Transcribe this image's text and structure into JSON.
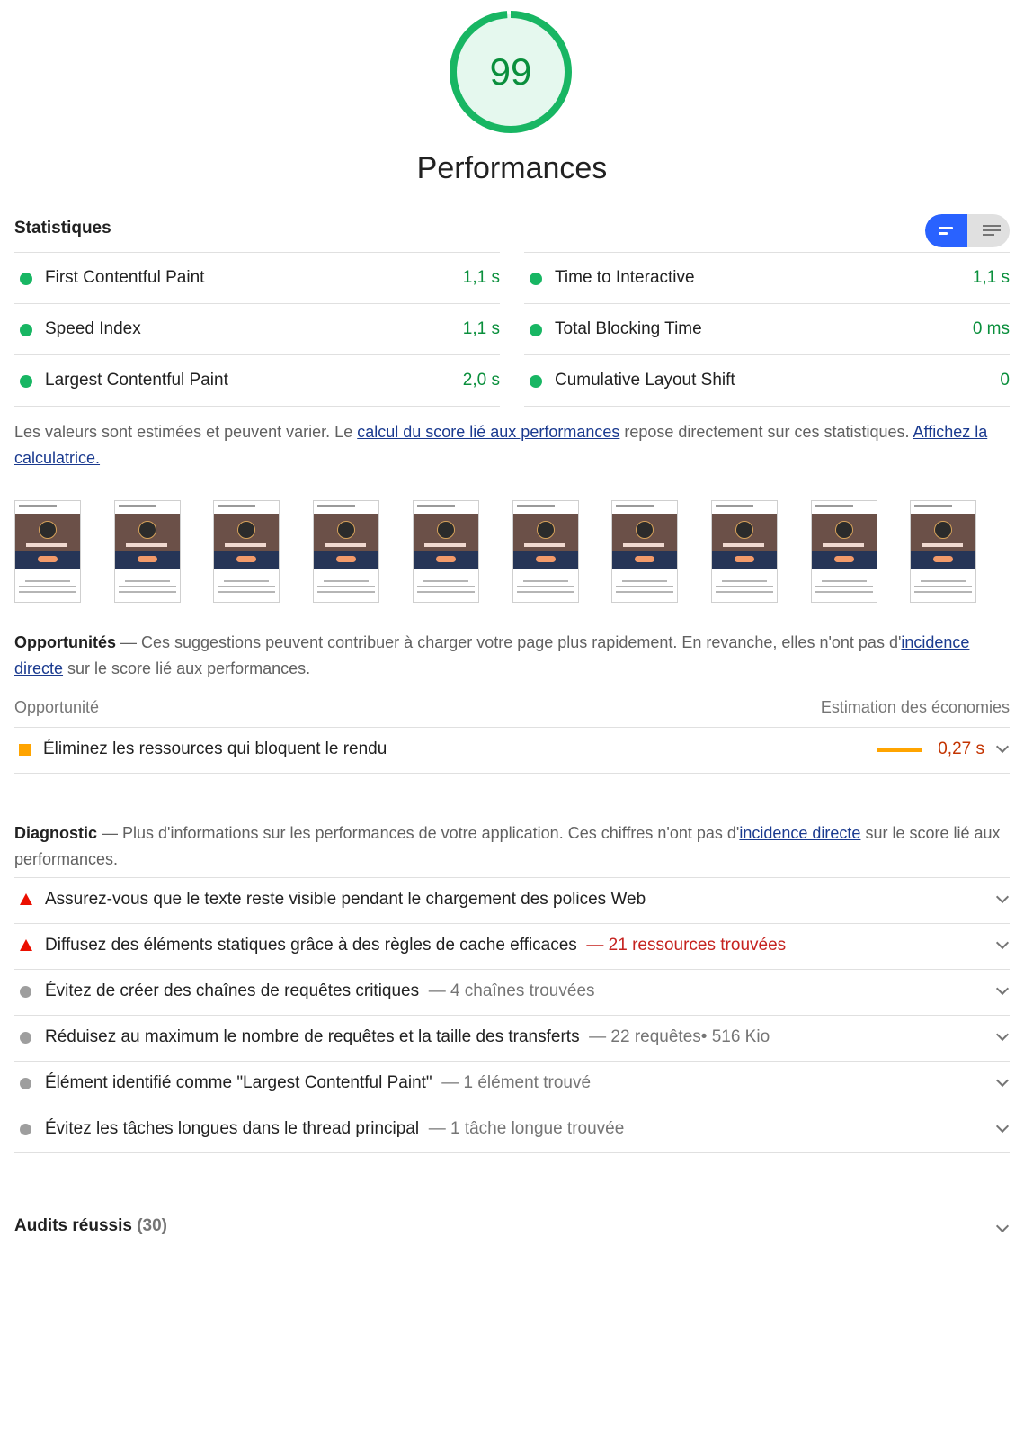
{
  "score": {
    "value": "99",
    "fraction": 0.99,
    "color": "#18b663"
  },
  "category_title": "Performances",
  "metrics": {
    "header": "Statistiques",
    "left": [
      {
        "label": "First Contentful Paint",
        "value": "1,1 s"
      },
      {
        "label": "Speed Index",
        "value": "1,1 s"
      },
      {
        "label": "Largest Contentful Paint",
        "value": "2,0 s"
      }
    ],
    "right": [
      {
        "label": "Time to Interactive",
        "value": "1,1 s"
      },
      {
        "label": "Total Blocking Time",
        "value": "0 ms"
      },
      {
        "label": "Cumulative Layout Shift",
        "value": "0"
      }
    ]
  },
  "note": {
    "part1": "Les valeurs sont estimées et peuvent varier. Le ",
    "link1": "calcul du score lié aux performances",
    "part2": " repose directement sur ces statistiques. ",
    "link2": "Affichez la calculatrice."
  },
  "opportunities": {
    "title": "Opportunités",
    "desc1": " — Ces suggestions peuvent contribuer à charger votre page plus rapidement. En revanche, elles n'ont pas d'",
    "link": "incidence directe",
    "desc2": " sur le score lié aux performances.",
    "col_left": "Opportunité",
    "col_right": "Estimation des économies",
    "items": [
      {
        "label": "Éliminez les ressources qui bloquent le rendu",
        "value": "0,27 s"
      }
    ]
  },
  "diagnostics": {
    "title": "Diagnostic",
    "desc1": " — Plus d'informations sur les performances de votre application. Ces chiffres n'ont pas d'",
    "link": "incidence directe",
    "desc2": " sur le score lié aux performances.",
    "items": [
      {
        "label": "Assurez-vous que le texte reste visible pendant le chargement des polices Web",
        "detail": "",
        "severity": "fail"
      },
      {
        "label": "Diffusez des éléments statiques grâce à des règles de cache efficaces",
        "detail": "— 21 ressources trouvées",
        "severity": "fail"
      },
      {
        "label": "Évitez de créer des chaînes de requêtes critiques",
        "detail": "— 4 chaînes trouvées",
        "severity": "info"
      },
      {
        "label": "Réduisez au maximum le nombre de requêtes et la taille des transferts",
        "detail": "— 22 requêtes• 516 Kio",
        "severity": "info"
      },
      {
        "label": "Élément identifié comme \"Largest Contentful Paint\"",
        "detail": "— 1 élément trouvé",
        "severity": "info"
      },
      {
        "label": "Évitez les tâches longues dans le thread principal",
        "detail": "— 1 tâche longue trouvée",
        "severity": "info"
      }
    ]
  },
  "passed": {
    "title": "Audits réussis",
    "count": "(30)"
  }
}
